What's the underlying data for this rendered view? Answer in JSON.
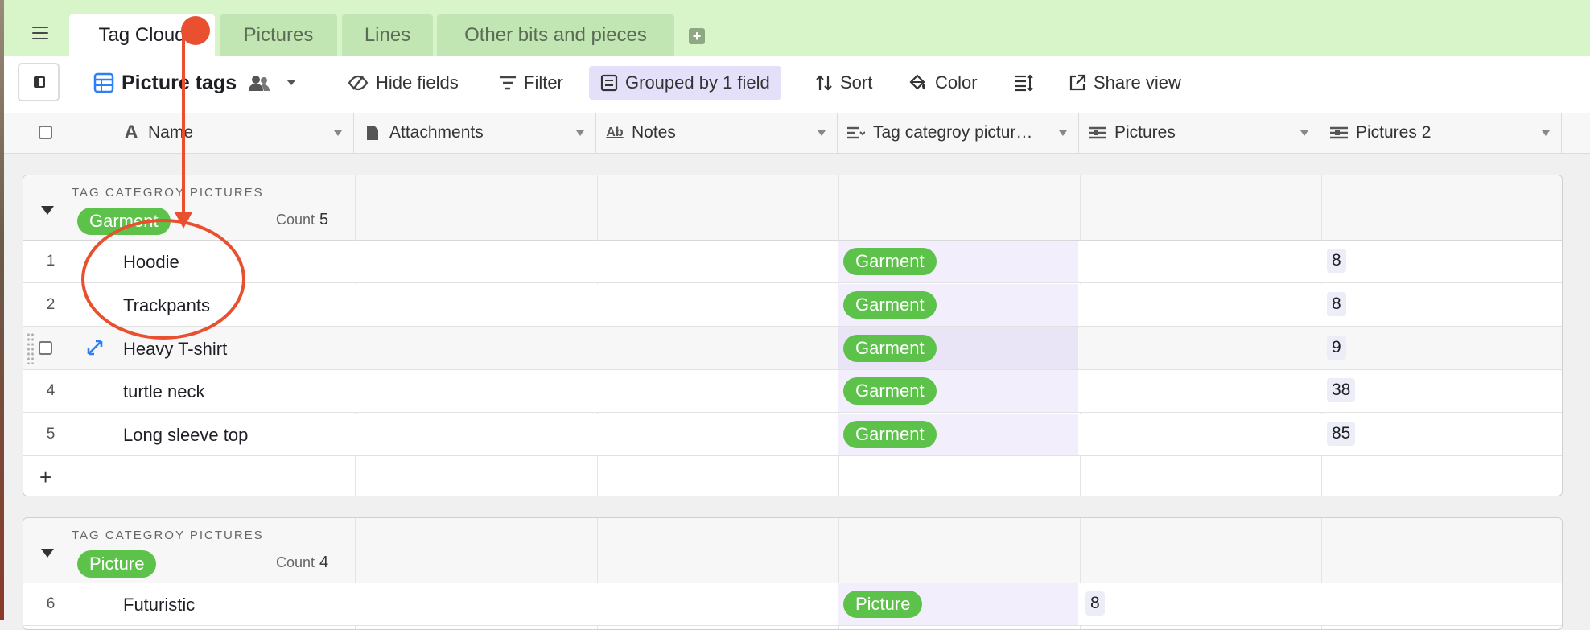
{
  "tabs": [
    {
      "label": "Tag Cloud",
      "active": true
    },
    {
      "label": "Pictures",
      "active": false
    },
    {
      "label": "Lines",
      "active": false
    },
    {
      "label": "Other bits and pieces",
      "active": false
    }
  ],
  "toolbar": {
    "view_name": "Picture tags",
    "hide_fields": "Hide fields",
    "filter": "Filter",
    "grouped": "Grouped by 1 field",
    "sort": "Sort",
    "color": "Color",
    "share_view": "Share view"
  },
  "columns": [
    "Name",
    "Attachments",
    "Notes",
    "Tag categroy pictur…",
    "Pictures",
    "Pictures 2"
  ],
  "groups": [
    {
      "label": "TAG CATEGROY PICTURES",
      "value": "Garment",
      "count_label": "Count",
      "count": "5",
      "rows": [
        {
          "num": "1",
          "name": "Hoodie",
          "tag": "Garment",
          "pictures2": "8"
        },
        {
          "num": "2",
          "name": "Trackpants",
          "tag": "Garment",
          "pictures2": "8"
        },
        {
          "num": "",
          "name": "Heavy T-shirt",
          "tag": "Garment",
          "pictures2": "9"
        },
        {
          "num": "4",
          "name": "turtle neck",
          "tag": "Garment",
          "pictures2": "38"
        },
        {
          "num": "5",
          "name": "Long sleeve top",
          "tag": "Garment",
          "pictures2": "85"
        }
      ],
      "add_row": "+"
    },
    {
      "label": "TAG CATEGROY PICTURES",
      "value": "Picture",
      "count_label": "Count",
      "count": "4",
      "rows": [
        {
          "num": "6",
          "name": "Futuristic",
          "tag": "Picture",
          "pictures": "8"
        }
      ]
    }
  ],
  "colors": {
    "tabbar": "#d7f5c8",
    "pill_green": "#5cc24a",
    "annotation_red": "#e8502f",
    "grouped_bg": "#e5e0f9"
  }
}
